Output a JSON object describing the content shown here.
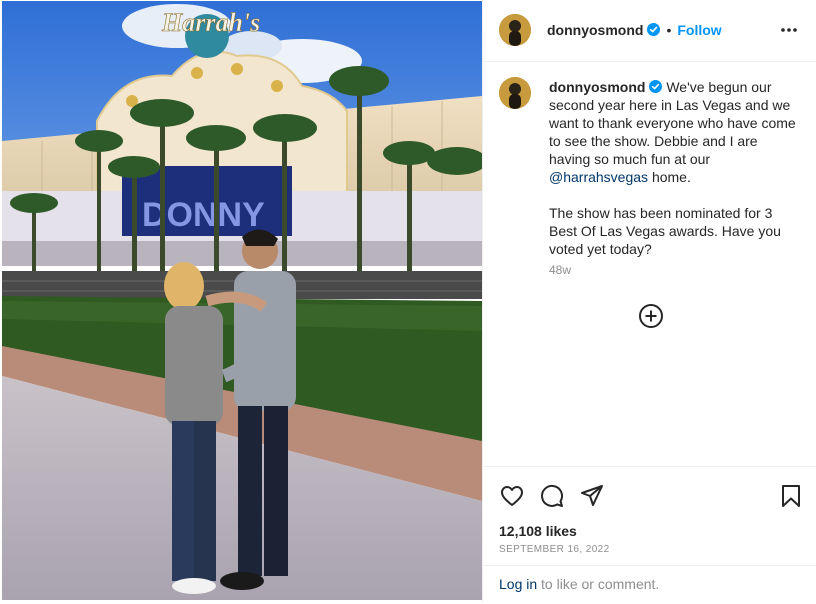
{
  "photo": {
    "sign_text": "Harrah's",
    "marquee_text": "DONNY"
  },
  "header": {
    "username": "donnyosmond",
    "separator": "•",
    "follow_label": "Follow",
    "icons": [
      "verified-badge-icon",
      "more-options-icon"
    ]
  },
  "caption": {
    "username": "donnyosmond",
    "text_part1": "We've begun our second year here in Las Vegas and we want to thank everyone who have come to see the show. Debbie and I are having so much fun at our",
    "mention": "@harrahsvegas",
    "text_part2": "home.",
    "paragraph2": "The show has been nominated for 3 Best Of Las Vegas awards. Have you voted yet today?",
    "age": "48w"
  },
  "load_more": {
    "icon": "plus-circle-icon"
  },
  "actions": {
    "icons": [
      "heart-icon",
      "comment-icon",
      "share-icon",
      "bookmark-icon"
    ],
    "likes": "12,108 likes",
    "date": "SEPTEMBER 16, 2022"
  },
  "login_prompt": {
    "link_label": "Log in",
    "rest_text": "to like or comment."
  },
  "colors": {
    "accent": "#0095f6",
    "link": "#00376b",
    "muted": "#8e8e8e",
    "text": "#262626",
    "border": "#efefef"
  }
}
